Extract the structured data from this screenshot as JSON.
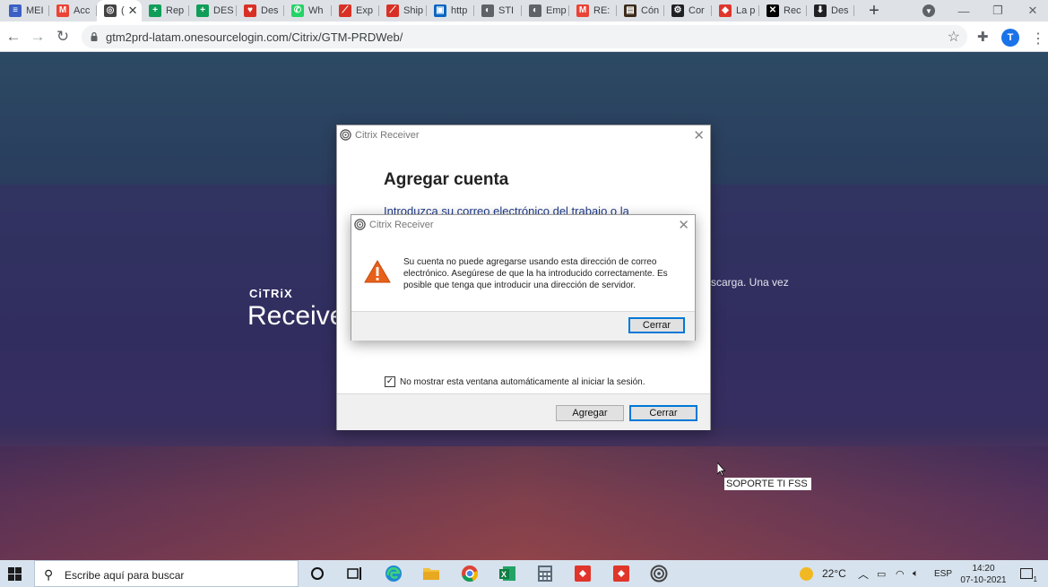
{
  "browser": {
    "tabs": [
      {
        "title": "MEI",
        "icon": "forms-icon",
        "color": "#3b5fc4",
        "glyph": "≡"
      },
      {
        "title": "Acc",
        "icon": "gmail-icon",
        "color": "#ea4335",
        "glyph": "M"
      },
      {
        "title": "(",
        "icon": "citrix-icon",
        "color": "#444444",
        "glyph": "◎",
        "active": true
      },
      {
        "title": "Rep",
        "icon": "sheets-icon",
        "color": "#0f9d58",
        "glyph": "+"
      },
      {
        "title": "DES",
        "icon": "sheets-icon",
        "color": "#0f9d58",
        "glyph": "+"
      },
      {
        "title": "Des",
        "icon": "heart-icon",
        "color": "#d93025",
        "glyph": "♥"
      },
      {
        "title": "Wh",
        "icon": "whatsapp-icon",
        "color": "#25d366",
        "glyph": "✆"
      },
      {
        "title": "Exp",
        "icon": "logistics-icon",
        "color": "#d93025",
        "glyph": "⟋"
      },
      {
        "title": "Ship",
        "icon": "logistics-icon",
        "color": "#d93025",
        "glyph": "⟋"
      },
      {
        "title": "http",
        "icon": "outlook-icon",
        "color": "#0a66c2",
        "glyph": "▣"
      },
      {
        "title": "STI",
        "icon": "globe-icon",
        "color": "#5f6368",
        "glyph": "◐"
      },
      {
        "title": "Emp",
        "icon": "globe-icon",
        "color": "#5f6368",
        "glyph": "◐"
      },
      {
        "title": "RE:",
        "icon": "gmail-icon",
        "color": "#ea4335",
        "glyph": "M"
      },
      {
        "title": "Cón",
        "icon": "terminal-icon",
        "color": "#3b2a1a",
        "glyph": "▤"
      },
      {
        "title": "Cor",
        "icon": "gear-icon",
        "color": "#202124",
        "glyph": "⚙"
      },
      {
        "title": "La p",
        "icon": "diamond-icon",
        "color": "#e0352b",
        "glyph": "◆"
      },
      {
        "title": "Rec",
        "icon": "x-icon",
        "color": "#000000",
        "glyph": "✕"
      },
      {
        "title": "Des",
        "icon": "download-icon",
        "color": "#202124",
        "glyph": "⬇"
      }
    ],
    "new_tab_label": "+",
    "url": "gtm2prd-latam.onesourcelogin.com/Citrix/GTM-PRDWeb/",
    "profile_initial": "T"
  },
  "page": {
    "brand_small": "CiTRiX",
    "brand_large": "Receiver",
    "side_text": "scarga. Una vez",
    "support_label": "SOPORTE TI FSS"
  },
  "main_dialog": {
    "title": "Citrix Receiver",
    "heading": "Agregar cuenta",
    "intro": "Introduzca su correo electrónico del trabajo o la",
    "checkbox_label": "No mostrar esta ventana automáticamente al iniciar la sesión.",
    "checkbox_checked": true,
    "add_button": "Agregar",
    "close_button": "Cerrar"
  },
  "error_dialog": {
    "title": "Citrix Receiver",
    "message": "Su cuenta no puede agregarse usando esta dirección de correo electrónico. Asegúrese de que la ha introducido correctamente. Es posible que tenga que introducir una dirección de servidor.",
    "close_button": "Cerrar",
    "icon": "warning-icon",
    "icon_color": "#e8611a"
  },
  "taskbar": {
    "search_placeholder": "Escribe aquí para buscar",
    "apps": [
      "cortana",
      "task-view",
      "edge",
      "file-explorer",
      "chrome",
      "excel",
      "calculator",
      "app-red-1",
      "app-red-2",
      "citrix"
    ],
    "weather": "22°C",
    "language": "ESP",
    "time": "14:20",
    "date": "07-10-2021",
    "notification_count": "1"
  }
}
